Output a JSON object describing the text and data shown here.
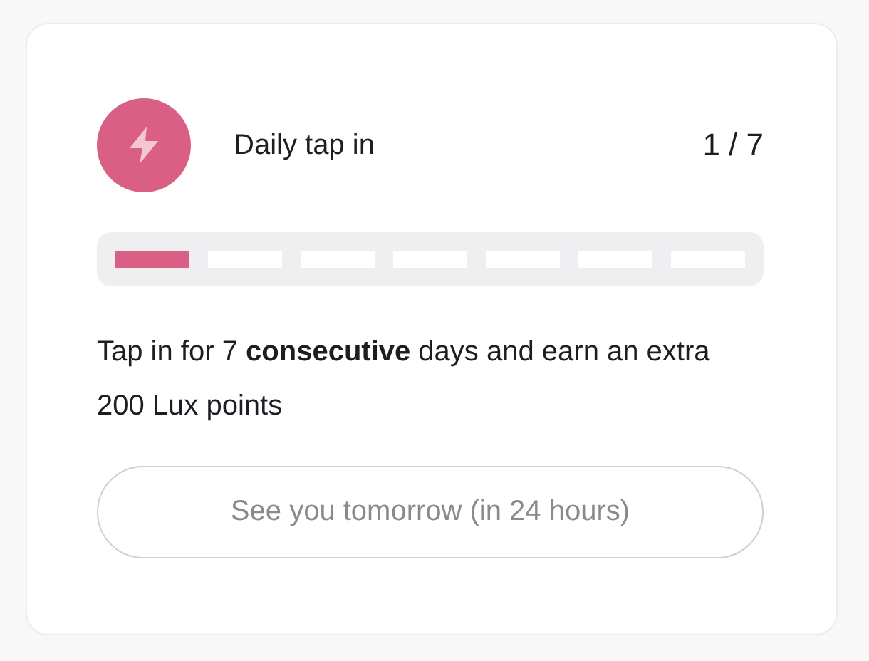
{
  "card": {
    "title": "Daily tap in",
    "count": "1 / 7",
    "segments": [
      {
        "filled": true
      },
      {
        "filled": false
      },
      {
        "filled": false
      },
      {
        "filled": false
      },
      {
        "filled": false
      },
      {
        "filled": false
      },
      {
        "filled": false
      }
    ],
    "description": "Tap in for 7 **consecutive** days and earn an extra 200 Lux points",
    "button": {
      "label": "See you tomorrow (in 24 hours)",
      "disabled": true
    }
  }
}
